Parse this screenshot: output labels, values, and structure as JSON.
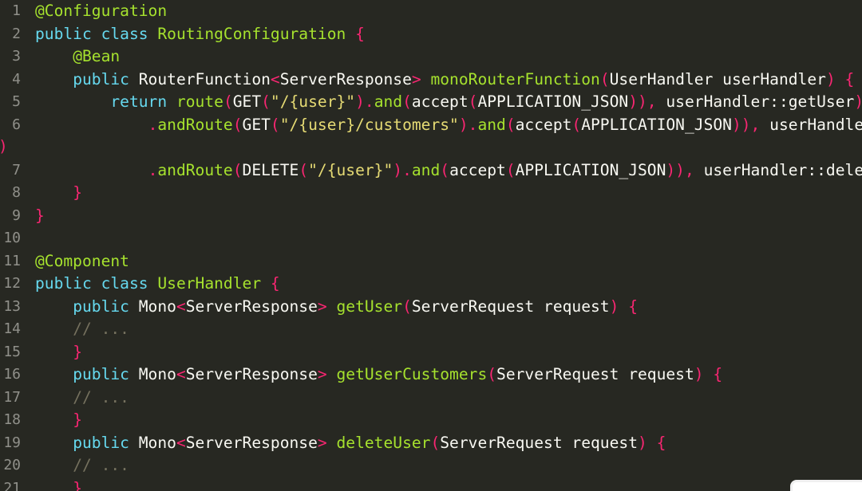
{
  "editor": {
    "wrap_marker": ")",
    "lines": [
      {
        "n": "1",
        "tokens": [
          {
            "t": "@Configuration",
            "c": "ann"
          }
        ]
      },
      {
        "n": "2",
        "tokens": [
          {
            "t": "public class ",
            "c": "kw"
          },
          {
            "t": "RoutingConfiguration",
            "c": "fn"
          },
          {
            "t": " {",
            "c": "op"
          }
        ]
      },
      {
        "n": "3",
        "tokens": [
          {
            "t": "    "
          },
          {
            "t": "@Bean",
            "c": "ann"
          }
        ]
      },
      {
        "n": "4",
        "tokens": [
          {
            "t": "    "
          },
          {
            "t": "public ",
            "c": "kw"
          },
          {
            "t": "RouterFunction"
          },
          {
            "t": "<",
            "c": "op"
          },
          {
            "t": "ServerResponse"
          },
          {
            "t": "> ",
            "c": "op"
          },
          {
            "t": "monoRouterFunction",
            "c": "fn"
          },
          {
            "t": "(",
            "c": "op"
          },
          {
            "t": "UserHandler userHandler"
          },
          {
            "t": ") {",
            "c": "op"
          }
        ]
      },
      {
        "n": "5",
        "tokens": [
          {
            "t": "        "
          },
          {
            "t": "return ",
            "c": "kw"
          },
          {
            "t": "route",
            "c": "fn"
          },
          {
            "t": "(",
            "c": "op"
          },
          {
            "t": "GET"
          },
          {
            "t": "(",
            "c": "op"
          },
          {
            "t": "\"/{user}\"",
            "c": "str"
          },
          {
            "t": ").",
            "c": "op"
          },
          {
            "t": "and",
            "c": "fn"
          },
          {
            "t": "(",
            "c": "op"
          },
          {
            "t": "accept"
          },
          {
            "t": "(",
            "c": "op"
          },
          {
            "t": "APPLICATION_JSON"
          },
          {
            "t": ")), ",
            "c": "op"
          },
          {
            "t": "userHandler::getUser"
          },
          {
            "t": ")",
            "c": "op"
          }
        ]
      },
      {
        "n": "6",
        "tokens": [
          {
            "t": "            "
          },
          {
            "t": ".",
            "c": "op"
          },
          {
            "t": "andRoute",
            "c": "fn"
          },
          {
            "t": "(",
            "c": "op"
          },
          {
            "t": "GET"
          },
          {
            "t": "(",
            "c": "op"
          },
          {
            "t": "\"/{user}/customers\"",
            "c": "str"
          },
          {
            "t": ").",
            "c": "op"
          },
          {
            "t": "and",
            "c": "fn"
          },
          {
            "t": "(",
            "c": "op"
          },
          {
            "t": "accept"
          },
          {
            "t": "(",
            "c": "op"
          },
          {
            "t": "APPLICATION_JSON"
          },
          {
            "t": ")), ",
            "c": "op"
          },
          {
            "t": "userHandler::getUserCustomers"
          }
        ]
      },
      {
        "n": "",
        "tokens": []
      },
      {
        "n": "7",
        "tokens": [
          {
            "t": "            "
          },
          {
            "t": ".",
            "c": "op"
          },
          {
            "t": "andRoute",
            "c": "fn"
          },
          {
            "t": "(",
            "c": "op"
          },
          {
            "t": "DELETE"
          },
          {
            "t": "(",
            "c": "op"
          },
          {
            "t": "\"/{user}\"",
            "c": "str"
          },
          {
            "t": ").",
            "c": "op"
          },
          {
            "t": "and",
            "c": "fn"
          },
          {
            "t": "(",
            "c": "op"
          },
          {
            "t": "accept"
          },
          {
            "t": "(",
            "c": "op"
          },
          {
            "t": "APPLICATION_JSON"
          },
          {
            "t": ")), ",
            "c": "op"
          },
          {
            "t": "userHandler::deleteUser"
          }
        ]
      },
      {
        "n": "8",
        "tokens": [
          {
            "t": "    "
          },
          {
            "t": "}",
            "c": "op"
          }
        ]
      },
      {
        "n": "9",
        "tokens": [
          {
            "t": "}",
            "c": "op"
          }
        ]
      },
      {
        "n": "10",
        "tokens": []
      },
      {
        "n": "11",
        "tokens": [
          {
            "t": "@Component",
            "c": "ann"
          }
        ]
      },
      {
        "n": "12",
        "tokens": [
          {
            "t": "public class ",
            "c": "kw"
          },
          {
            "t": "UserHandler",
            "c": "fn"
          },
          {
            "t": " {",
            "c": "op"
          }
        ]
      },
      {
        "n": "13",
        "tokens": [
          {
            "t": "    "
          },
          {
            "t": "public ",
            "c": "kw"
          },
          {
            "t": "Mono"
          },
          {
            "t": "<",
            "c": "op"
          },
          {
            "t": "ServerResponse"
          },
          {
            "t": "> ",
            "c": "op"
          },
          {
            "t": "getUser",
            "c": "fn"
          },
          {
            "t": "(",
            "c": "op"
          },
          {
            "t": "ServerRequest request"
          },
          {
            "t": ") {",
            "c": "op"
          }
        ]
      },
      {
        "n": "14",
        "tokens": [
          {
            "t": "    "
          },
          {
            "t": "// ...",
            "c": "cm"
          }
        ]
      },
      {
        "n": "15",
        "tokens": [
          {
            "t": "    "
          },
          {
            "t": "}",
            "c": "op"
          }
        ]
      },
      {
        "n": "16",
        "tokens": [
          {
            "t": "    "
          },
          {
            "t": "public ",
            "c": "kw"
          },
          {
            "t": "Mono"
          },
          {
            "t": "<",
            "c": "op"
          },
          {
            "t": "ServerResponse"
          },
          {
            "t": "> ",
            "c": "op"
          },
          {
            "t": "getUserCustomers",
            "c": "fn"
          },
          {
            "t": "(",
            "c": "op"
          },
          {
            "t": "ServerRequest request"
          },
          {
            "t": ") {",
            "c": "op"
          }
        ]
      },
      {
        "n": "17",
        "tokens": [
          {
            "t": "    "
          },
          {
            "t": "// ...",
            "c": "cm"
          }
        ]
      },
      {
        "n": "18",
        "tokens": [
          {
            "t": "    "
          },
          {
            "t": "}",
            "c": "op"
          }
        ]
      },
      {
        "n": "19",
        "tokens": [
          {
            "t": "    "
          },
          {
            "t": "public ",
            "c": "kw"
          },
          {
            "t": "Mono"
          },
          {
            "t": "<",
            "c": "op"
          },
          {
            "t": "ServerResponse"
          },
          {
            "t": "> ",
            "c": "op"
          },
          {
            "t": "deleteUser",
            "c": "fn"
          },
          {
            "t": "(",
            "c": "op"
          },
          {
            "t": "ServerRequest request"
          },
          {
            "t": ") {",
            "c": "op"
          }
        ]
      },
      {
        "n": "20",
        "tokens": [
          {
            "t": "    "
          },
          {
            "t": "// ...",
            "c": "cm"
          }
        ]
      },
      {
        "n": "21",
        "tokens": [
          {
            "t": "    "
          },
          {
            "t": "}",
            "c": "op"
          }
        ]
      }
    ]
  },
  "colors": {
    "background": "#272822",
    "keyword": "#66d9ef",
    "annotation": "#a6e22e",
    "function": "#a6e22e",
    "string": "#e6db74",
    "operator": "#f92672",
    "comment": "#75715e",
    "text": "#f8f8f2",
    "line_number": "#90908a"
  }
}
